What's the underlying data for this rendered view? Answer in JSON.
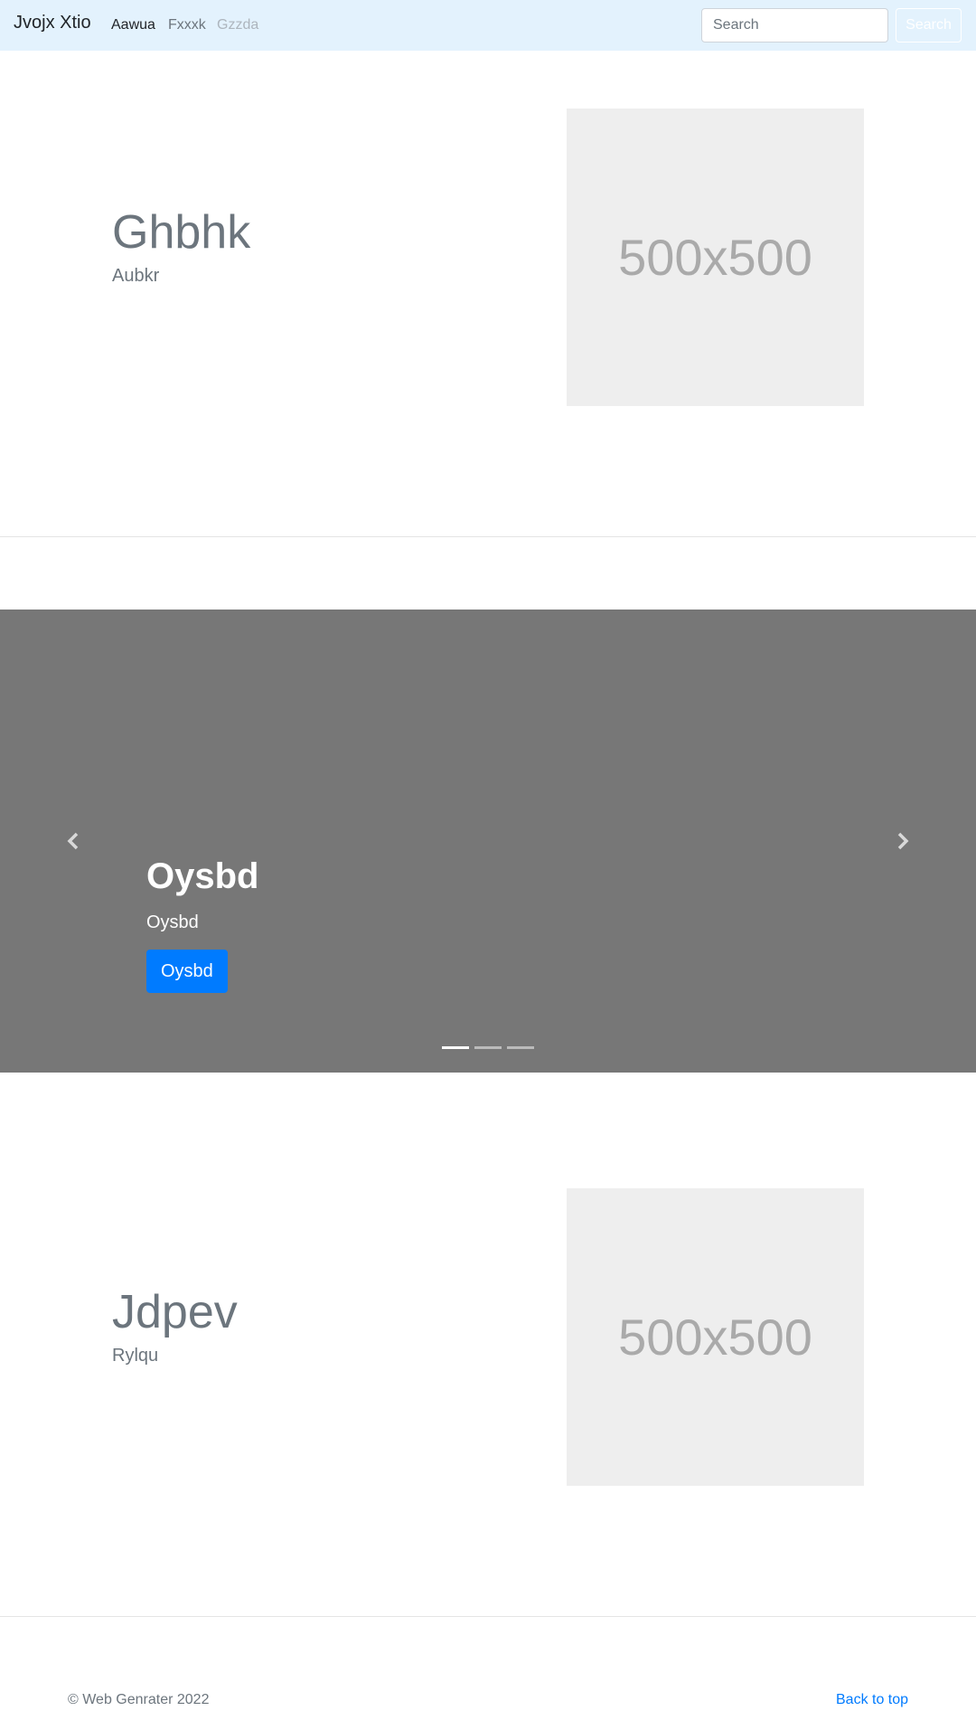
{
  "navbar": {
    "brand": "Jvojx Xtio",
    "links": [
      {
        "label": "Aawua",
        "state": "active"
      },
      {
        "label": "Fxxxk",
        "state": "normal"
      },
      {
        "label": "Gzzda",
        "state": "disabled"
      }
    ],
    "search_placeholder": "Search",
    "search_button": "Search",
    "background_color": "#e3f2fd"
  },
  "features": [
    {
      "heading": "Ghbhk",
      "subheading": "Aubkr",
      "image_label": "500x500"
    },
    {
      "heading": "Jdpev",
      "subheading": "Rylqu",
      "image_label": "500x500"
    }
  ],
  "carousel": {
    "slides": [
      {
        "heading": "Oysbd",
        "text": "Oysbd",
        "button_label": "Oysbd"
      }
    ],
    "indicator_count": 3,
    "active_index": 0,
    "prev_icon": "chevron-left-icon",
    "next_icon": "chevron-right-icon",
    "background_color": "#777777"
  },
  "footer": {
    "copyright": "© Web Genrater 2022",
    "back_to_top": "Back to top"
  },
  "colors": {
    "primary": "#007bff",
    "muted": "#6c757d",
    "placeholder_bg": "#eeeeee"
  }
}
